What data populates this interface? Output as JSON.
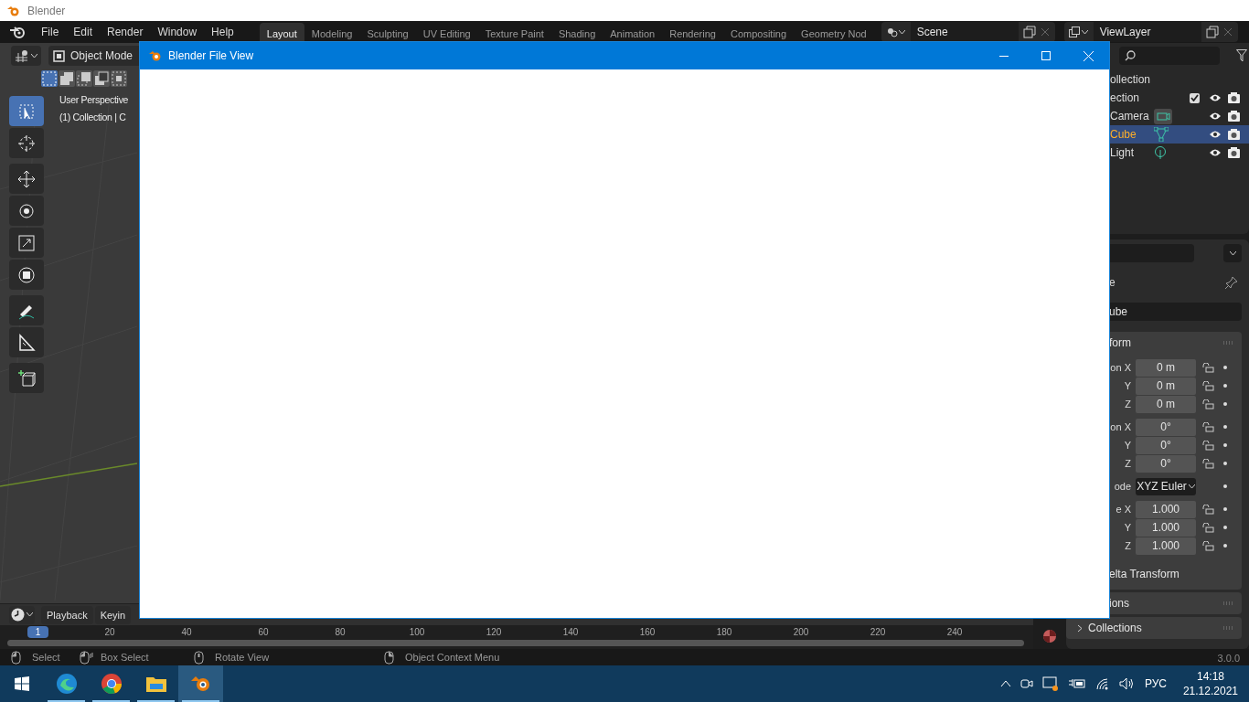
{
  "os_window": {
    "title": "Blender"
  },
  "menu_bar": {
    "items": [
      "File",
      "Edit",
      "Render",
      "Window",
      "Help"
    ]
  },
  "workspace_tabs": [
    {
      "label": "Layout",
      "selected": true
    },
    {
      "label": "Modeling",
      "selected": false
    },
    {
      "label": "Sculpting",
      "selected": false
    },
    {
      "label": "UV Editing",
      "selected": false
    },
    {
      "label": "Texture Paint",
      "selected": false
    },
    {
      "label": "Shading",
      "selected": false
    },
    {
      "label": "Animation",
      "selected": false
    },
    {
      "label": "Rendering",
      "selected": false
    },
    {
      "label": "Compositing",
      "selected": false
    },
    {
      "label": "Geometry Nod",
      "selected": false
    }
  ],
  "scene": {
    "name": "Scene"
  },
  "view_layer": {
    "name": "ViewLayer"
  },
  "viewport": {
    "mode": "Object Mode",
    "select_modes": [
      {
        "selected": true
      },
      {
        "selected": false
      },
      {
        "selected": false
      },
      {
        "selected": false
      },
      {
        "selected": false
      }
    ],
    "overlay_lines": [
      "User Perspective",
      "(1) Collection | C"
    ],
    "tools": [
      {
        "kind": "select",
        "selected": true
      },
      {
        "kind": "cursor",
        "selected": false
      },
      {
        "kind": "move",
        "selected": false
      },
      {
        "kind": "rotate",
        "selected": false
      },
      {
        "kind": "scale",
        "selected": false
      },
      {
        "kind": "transform",
        "selected": false
      },
      {
        "kind": "annotate",
        "selected": false
      },
      {
        "kind": "measure",
        "selected": false
      },
      {
        "kind": "add_cube",
        "selected": false
      }
    ]
  },
  "outliner": {
    "rows": [
      {
        "label": "ollection",
        "kind": "scene_collection",
        "selected": false
      },
      {
        "label": "ection",
        "kind": "collection",
        "selected": false,
        "checked": true
      },
      {
        "label": "Camera",
        "kind": "camera",
        "selected": false
      },
      {
        "label": "Cube",
        "kind": "mesh",
        "selected": true
      },
      {
        "label": "Light",
        "kind": "light",
        "selected": false
      }
    ]
  },
  "properties": {
    "section_label": "e",
    "object_name": "ube",
    "panel_title": "form",
    "rows": [
      {
        "kind": "field",
        "label": "on X",
        "value": "0 m"
      },
      {
        "kind": "field",
        "label": "Y",
        "value": "0 m"
      },
      {
        "kind": "field",
        "label": "Z",
        "value": "0 m"
      },
      {
        "kind": "gap"
      },
      {
        "kind": "field",
        "label": "on X",
        "value": "0°"
      },
      {
        "kind": "field",
        "label": "Y",
        "value": "0°"
      },
      {
        "kind": "field",
        "label": "Z",
        "value": "0°"
      },
      {
        "kind": "gap"
      },
      {
        "kind": "dropdown",
        "label": "ode",
        "value": "XYZ Euler"
      },
      {
        "kind": "gap"
      },
      {
        "kind": "field",
        "label": "e X",
        "value": "1.000"
      },
      {
        "kind": "field",
        "label": "Y",
        "value": "1.000"
      },
      {
        "kind": "field",
        "label": "Z",
        "value": "1.000"
      }
    ],
    "subpanels": [
      {
        "label": "elta Transform",
        "kind": "cut"
      }
    ],
    "panels": [
      {
        "label": "ions",
        "kind": "cut"
      },
      {
        "label": "Collections",
        "kind": "collapsed"
      }
    ]
  },
  "timeline": {
    "menus": [
      "Playback",
      "Keyin"
    ],
    "current_frame": "1",
    "ticks": [
      "20",
      "40",
      "60",
      "80",
      "100",
      "120",
      "140",
      "160",
      "180",
      "200",
      "220",
      "240"
    ]
  },
  "status_bar": {
    "hints": [
      {
        "label": "Select",
        "kind": "left"
      },
      {
        "label": "Box Select",
        "kind": "left_drag"
      },
      {
        "label": "Rotate View",
        "kind": "middle"
      },
      {
        "label": "Object Context Menu",
        "kind": "right"
      }
    ],
    "version": "3.0.0"
  },
  "dialog": {
    "title": "Blender File View"
  },
  "taskbar": {
    "apps": [
      {
        "kind": "edge",
        "selected": false,
        "running": true
      },
      {
        "kind": "chrome",
        "selected": false,
        "running": true
      },
      {
        "kind": "explorer",
        "selected": false,
        "running": true
      },
      {
        "kind": "blender",
        "selected": true,
        "running": true
      }
    ],
    "language": "РУС",
    "time": "14:18",
    "date": "21.12.2021"
  }
}
